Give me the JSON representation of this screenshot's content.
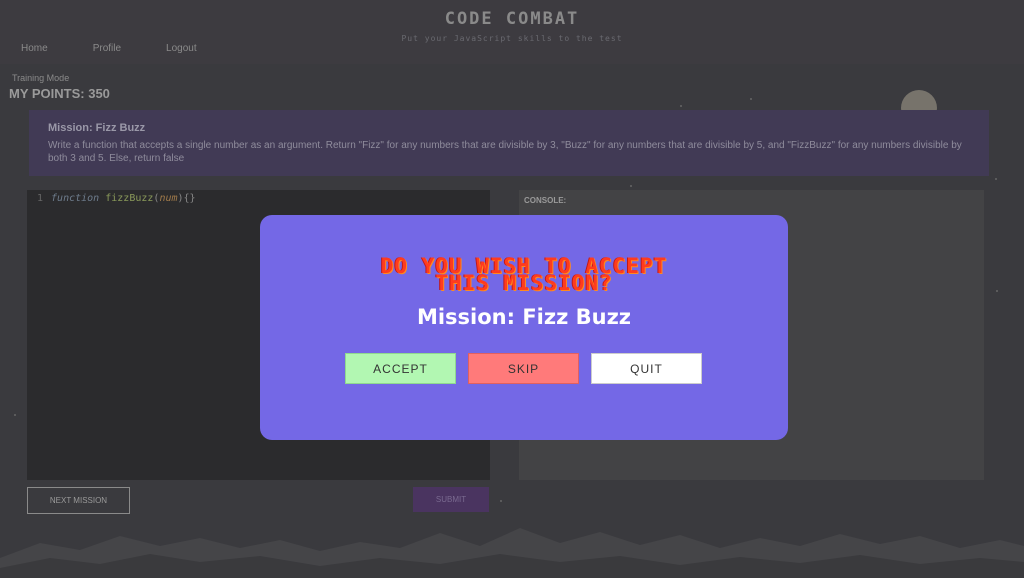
{
  "header": {
    "title": "CODE COMBAT",
    "tagline": "Put your JavaScript skills to the test",
    "nav": [
      "Home",
      "Profile",
      "Logout"
    ]
  },
  "status": {
    "mode": "Training Mode",
    "points": "MY POINTS: 350"
  },
  "mission": {
    "title": "Mission: Fizz Buzz",
    "description": "Write a function that accepts a single number as an argument. Return \"Fizz\" for any numbers that are divisible by 3, \"Buzz\" for any numbers that are divisible by 5, and \"FizzBuzz\" for any numbers divisible by both 3 and 5. Else, return false"
  },
  "editor": {
    "line_number": "1",
    "keyword": "function",
    "function_name": "fizzBuzz",
    "argument": "num",
    "open_paren": "(",
    "close": "){}"
  },
  "console": {
    "label": "CONSOLE:"
  },
  "buttons": {
    "next_mission": "NEXT MISSION",
    "submit": "SUBMIT"
  },
  "modal": {
    "heading_line1": "DO YOU WISH TO ACCEPT",
    "heading_line2": "THIS MISSION?",
    "mission_title": "Mission: Fizz Buzz",
    "accept": "ACCEPT",
    "skip": "SKIP",
    "quit": "QUIT"
  },
  "colors": {
    "modal_bg": "#7468e6",
    "accept_bg": "#b2f7b2",
    "skip_bg": "#ff7a7a",
    "quit_bg": "#ffffff",
    "heading": "#ff3b1f"
  }
}
